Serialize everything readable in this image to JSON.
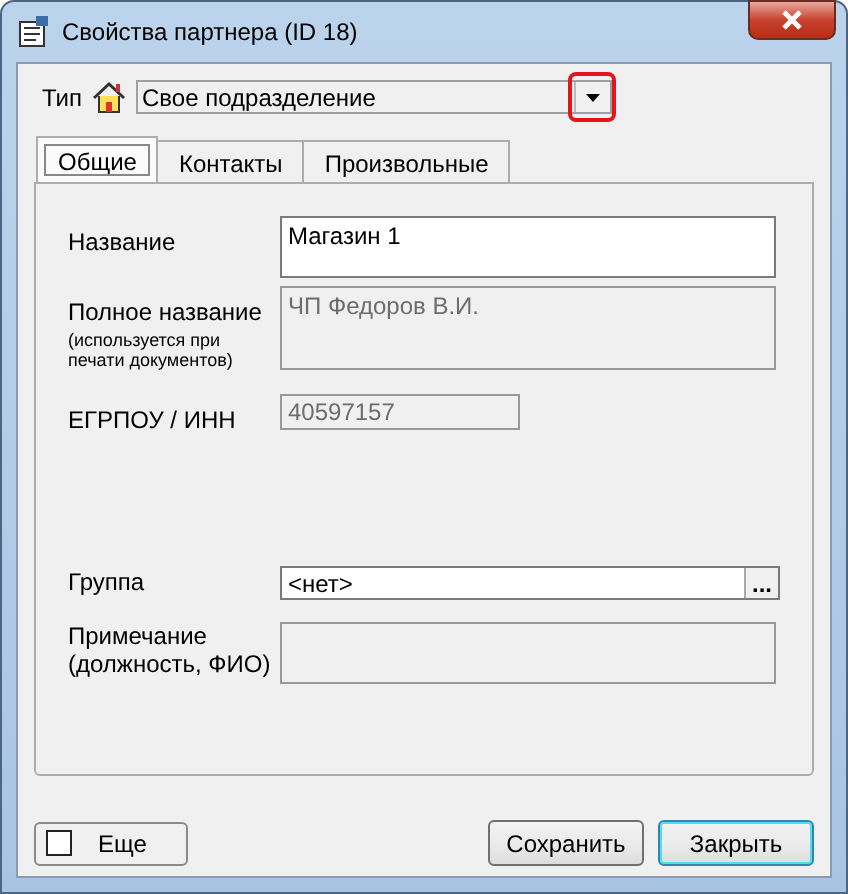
{
  "window": {
    "title": "Свойства партнера  (ID 18)"
  },
  "type": {
    "label": "Тип",
    "value": "Свое подразделение",
    "highlighted": true
  },
  "tabs": [
    {
      "label": "Общие",
      "selected": true
    },
    {
      "label": "Контакты",
      "selected": false
    },
    {
      "label": "Произвольные",
      "selected": false
    }
  ],
  "fields": [
    {
      "kind": "tall",
      "label": "Название",
      "value": "Магазин 1",
      "disabled": false
    },
    {
      "kind": "tall",
      "label": "Полное название",
      "note": "(используется при печати документов)",
      "value": "ЧП Федоров В.И.",
      "disabled": true
    },
    {
      "kind": "short",
      "label": "ЕГРПОУ / ИНН",
      "value": "40597157",
      "disabled": true
    },
    {
      "kind": "browse",
      "label": "Группа",
      "value": "<нет>",
      "disabled": false,
      "button": "..."
    },
    {
      "kind": "tall",
      "label": "Примечание (должность, ФИО)",
      "disabled": true
    }
  ],
  "more": {
    "label": "Еще",
    "checked": false
  },
  "buttons": [
    {
      "label": "Сохранить",
      "default": false
    },
    {
      "label": "Закрыть",
      "default": true
    }
  ]
}
